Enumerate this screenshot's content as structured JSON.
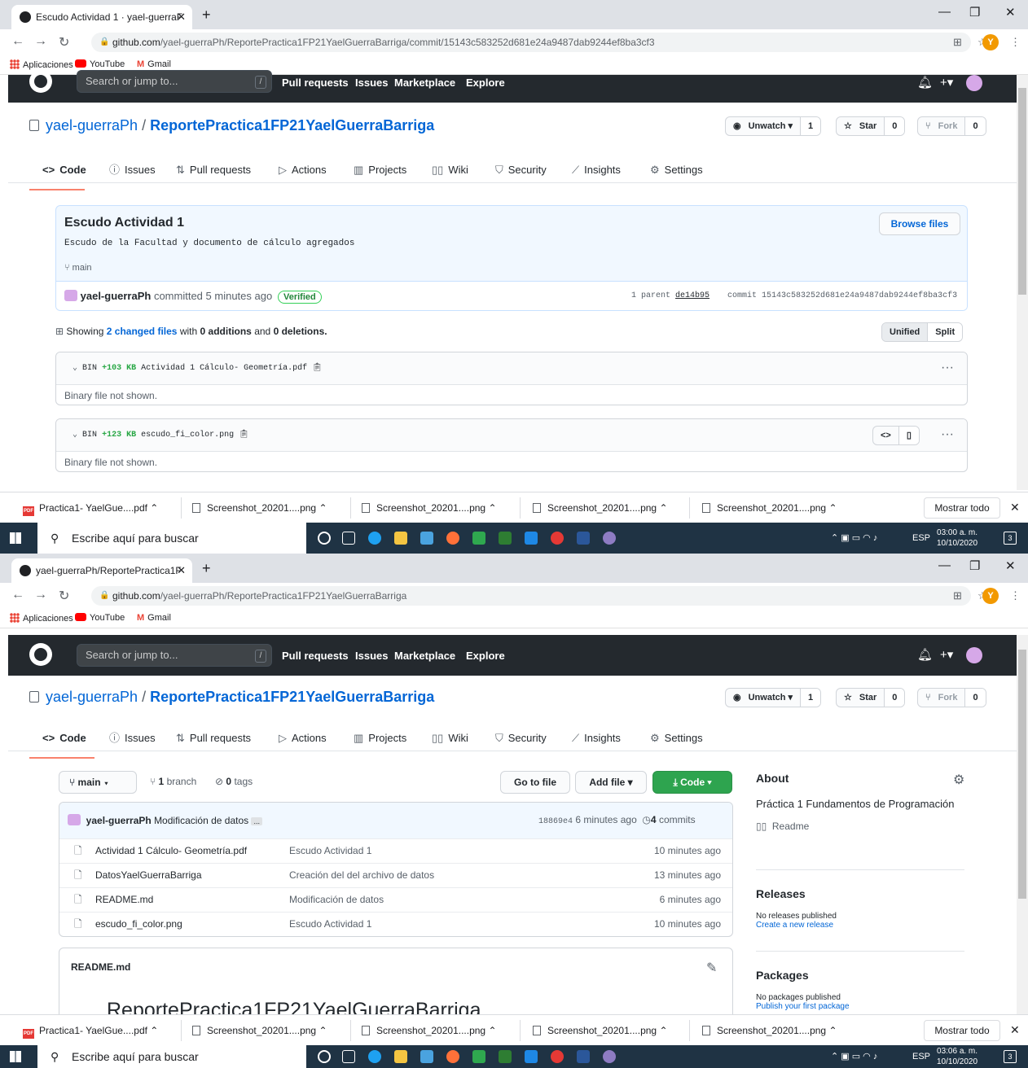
{
  "shot1": {
    "tab_title": "Escudo Actividad 1 · yael-guerraF",
    "url_host": "github.com",
    "url_path": "/yael-guerraPh/ReportePractica1FP21YaelGuerraBarriga/commit/15143c583252d681e24a9487dab9244ef8ba3cf3",
    "bookmarks": [
      "Aplicaciones",
      "YouTube",
      "Gmail"
    ],
    "search_placeholder": "Search or jump to...",
    "nav": [
      "Pull requests",
      "Issues",
      "Marketplace",
      "Explore"
    ],
    "owner": "yael-guerraPh",
    "sep": "/",
    "repo": "ReportePractica1FP21YaelGuerraBarriga",
    "unwatch": "Unwatch ▾",
    "watch_count": "1",
    "star": "Star",
    "star_count": "0",
    "fork": "Fork",
    "fork_count": "0",
    "tabs": [
      "Code",
      "Issues",
      "Pull requests",
      "Actions",
      "Projects",
      "Wiki",
      "Security",
      "Insights",
      "Settings"
    ],
    "commit": {
      "title": "Escudo Actividad 1",
      "browse": "Browse files",
      "desc": "Escudo de la Facultad y documento de cálculo agregados",
      "branch": "main",
      "author": "yael-guerraPh",
      "committed": "committed 5 minutes ago",
      "verified": "Verified",
      "parent_label": "1 parent",
      "parent_sha": "de14b95",
      "commit_label": "commit",
      "sha": "15143c583252d681e24a9487dab9244ef8ba3cf3"
    },
    "summary": {
      "pre": "Showing",
      "changed": "2 changed files",
      "mid": "with",
      "adds": "0 additions",
      "and": "and",
      "dels": "0 deletions."
    },
    "view_unified": "Unified",
    "view_split": "Split",
    "files": [
      {
        "type": "BIN",
        "size": "+103 KB",
        "name": "Actividad 1 Cálculo- Geometría.pdf",
        "body": "Binary file not shown."
      },
      {
        "type": "BIN",
        "size": "+123 KB",
        "name": "escudo_fi_color.png",
        "body": "Binary file not shown."
      }
    ],
    "downloads": [
      "Practica1- YaelGue....pdf",
      "Screenshot_20201....png",
      "Screenshot_20201....png",
      "Screenshot_20201....png",
      "Screenshot_20201....png"
    ],
    "show_all": "Mostrar todo",
    "taskbar_search": "Escribe aquí para buscar",
    "lang": "ESP",
    "time": "03:00 a. m.",
    "date": "10/10/2020",
    "notif_count": "3"
  },
  "shot2": {
    "tab_title": "yael-guerraPh/ReportePractica1F",
    "url_host": "github.com",
    "url_path": "/yael-guerraPh/ReportePractica1FP21YaelGuerraBarriga",
    "bookmarks": [
      "Aplicaciones",
      "YouTube",
      "Gmail"
    ],
    "search_placeholder": "Search or jump to...",
    "nav": [
      "Pull requests",
      "Issues",
      "Marketplace",
      "Explore"
    ],
    "owner": "yael-guerraPh",
    "sep": "/",
    "repo": "ReportePractica1FP21YaelGuerraBarriga",
    "unwatch": "Unwatch ▾",
    "watch_count": "1",
    "star": "Star",
    "star_count": "0",
    "fork": "Fork",
    "fork_count": "0",
    "tabs": [
      "Code",
      "Issues",
      "Pull requests",
      "Actions",
      "Projects",
      "Wiki",
      "Security",
      "Insights",
      "Settings"
    ],
    "branch_btn": "main ▾",
    "branches_num": "1",
    "branches_label": "branch",
    "tags_num": "0",
    "tags_label": "tags",
    "go_to_file": "Go to file",
    "add_file": "Add file ▾",
    "code_btn": "Code ▾",
    "last_commit": {
      "author": "yael-guerraPh",
      "message": "Modificación de datos",
      "more": "...",
      "sha": "18869e4",
      "age": "6 minutes ago",
      "commits_num": "4",
      "commits_label": "commits"
    },
    "files": [
      {
        "name": "Actividad 1 Cálculo- Geometría.pdf",
        "message": "Escudo Actividad 1",
        "age": "10 minutes ago"
      },
      {
        "name": "DatosYaelGuerraBarriga",
        "message": "Creación del del archivo de datos",
        "age": "13 minutes ago"
      },
      {
        "name": "README.md",
        "message": "Modificación de datos",
        "age": "6 minutes ago"
      },
      {
        "name": "escudo_fi_color.png",
        "message": "Escudo Actividad 1",
        "age": "10 minutes ago"
      }
    ],
    "readme_title": "README.md",
    "readme_heading": "ReportePractica1FP21YaelGuerraBarriga",
    "about": {
      "title": "About",
      "desc": "Práctica 1 Fundamentos de Programación",
      "readme": "Readme"
    },
    "releases": {
      "title": "Releases",
      "none": "No releases published",
      "link": "Create a new release"
    },
    "packages": {
      "title": "Packages",
      "none": "No packages published",
      "link": "Publish your first package"
    },
    "downloads": [
      "Practica1- YaelGue....pdf",
      "Screenshot_20201....png",
      "Screenshot_20201....png",
      "Screenshot_20201....png",
      "Screenshot_20201....png"
    ],
    "show_all": "Mostrar todo",
    "taskbar_search": "Escribe aquí para buscar",
    "lang": "ESP",
    "time": "03:06 a. m.",
    "date": "10/10/2020",
    "notif_count": "3"
  },
  "colors": {
    "accent_link": "#0366d6",
    "header_bg": "#24292e",
    "green_button": "#2ea44f",
    "tab_underline": "#f9826c",
    "taskbar": "#1f3344"
  }
}
